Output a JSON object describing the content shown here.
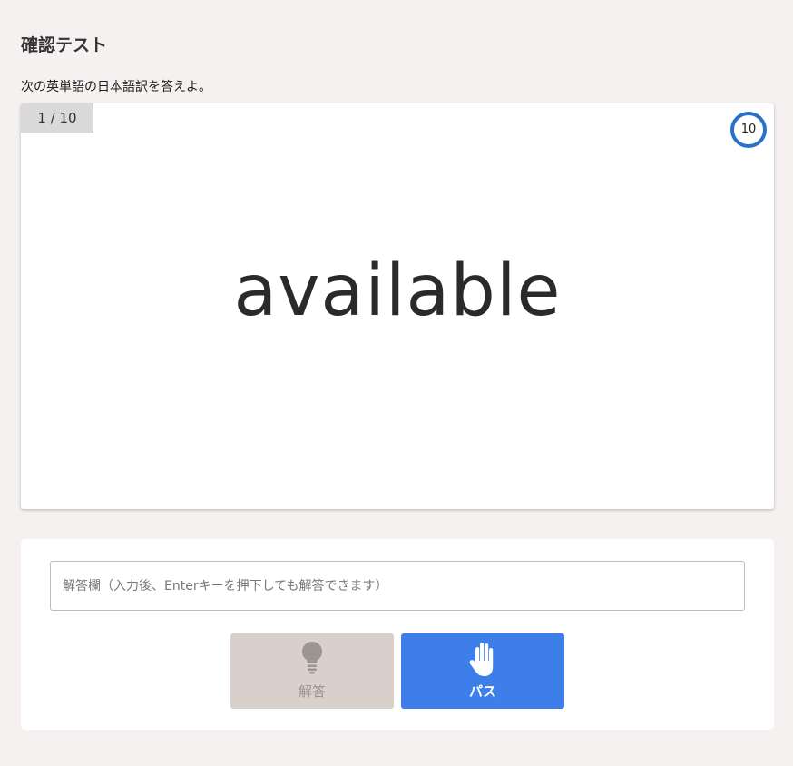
{
  "page": {
    "title": "確認テスト",
    "instruction": "次の英単語の日本語訳を答えよ。"
  },
  "question": {
    "progress": "1 / 10",
    "timer": "10",
    "word": "available"
  },
  "answer": {
    "placeholder": "解答欄（入力後、Enterキーを押下しても解答できます）",
    "value": ""
  },
  "buttons": {
    "hint_label": "解答",
    "hint_icon": "lightbulb-icon",
    "pass_label": "パス",
    "pass_icon": "hand-icon"
  },
  "colors": {
    "background": "#f4f1f0",
    "timer_ring": "#2a72c9",
    "pass_button": "#3d7ee8",
    "hint_button": "#d9d0cb"
  }
}
